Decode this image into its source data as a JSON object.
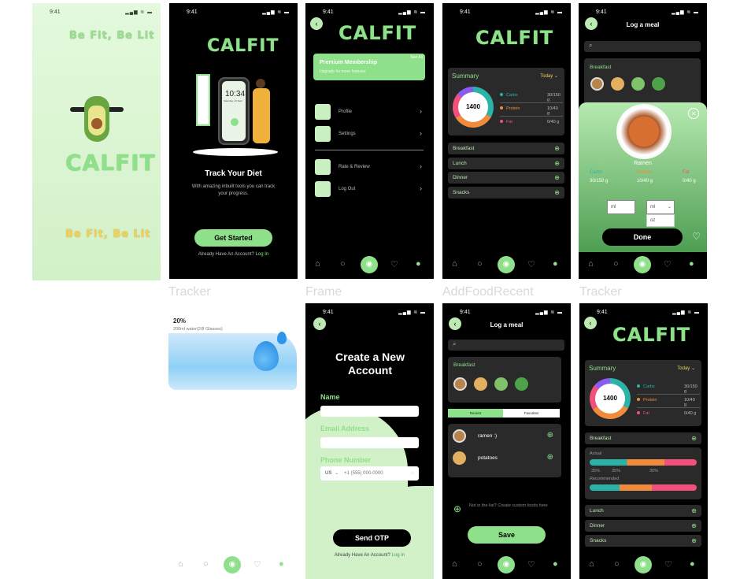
{
  "status": {
    "time": "9:41",
    "icons": "▂▄▆ ≋ ▬"
  },
  "nav_icons": [
    "home-icon",
    "search-icon",
    "camera-icon",
    "heart-icon",
    "profile-icon"
  ],
  "labels": {
    "tracker1": "Tracker",
    "frame": "Frame",
    "addfood": "AddFoodRecent",
    "tracker2": "Tracker"
  },
  "splash": {
    "tagline": "Be Fit, Be Lit",
    "brand": "CALFIT",
    "tagline_bottom": "Be Fit, Be Lit"
  },
  "onboard": {
    "brand": "CALFIT",
    "phone_time": "10:34",
    "phone_date": "Saturday, 24 Sept",
    "title": "Track Your Diet",
    "desc": "With amazing inbuilt tools you can track your progress.",
    "cta": "Get Started",
    "footer_q": "Already Have An Account?",
    "footer_link": "Log In"
  },
  "menu": {
    "brand": "CALFIT",
    "premium_title": "Premium Membership",
    "premium_badge": "See All",
    "premium_sub": "Upgrade for more features",
    "items": [
      "Profile",
      "Settings",
      "Rate & Review",
      "Log Out"
    ]
  },
  "summary": {
    "brand": "CALFIT",
    "title": "Summary",
    "period": "Today",
    "kcal": "1400",
    "macros": [
      {
        "name": "Carbs",
        "value": "30/150 g",
        "color": "#2ab3a6"
      },
      {
        "name": "Protein",
        "value": "10/40 g",
        "color": "#f08a3c"
      },
      {
        "name": "Fat",
        "value": "0/40 g",
        "color": "#f0507a"
      }
    ],
    "meals": [
      "Breakfast",
      "Lunch",
      "Dinner",
      "Snacks"
    ]
  },
  "logmeal": {
    "title": "Log a meal",
    "section": "Breakfast",
    "food_name": "Ramen",
    "macros": [
      {
        "name": "Carbs",
        "value": "30/150 g"
      },
      {
        "name": "Protein",
        "value": "10/40 g"
      },
      {
        "name": "Fat",
        "value": "0/40 g"
      }
    ],
    "unit_input": "ml",
    "unit_select": "ml",
    "unit_option": "oz",
    "done": "Done"
  },
  "water": {
    "percent": "20%",
    "desc": "200ml water(2/8 Glasses)"
  },
  "signup": {
    "title": "Create a New Account",
    "name_label": "Name",
    "email_label": "Email Address",
    "phone_label": "Phone Number",
    "country": "US",
    "phone_placeholder": "+1 (555) 000-0000",
    "cta": "Send OTP",
    "footer_q": "Already Have An Account?",
    "footer_link": "Log In"
  },
  "addfood": {
    "title": "Log a meal",
    "section": "Breakfast",
    "tab_recent": "Recent",
    "tab_favs": "Favorites",
    "items": [
      "ramen :)",
      "potatoes"
    ],
    "custom": "Not in the list? Create custom foods here",
    "save": "Save"
  },
  "tracker2": {
    "brand": "CALFIT",
    "title": "Summary",
    "period": "Today",
    "kcal": "1400",
    "macros": [
      {
        "name": "Carbs",
        "value": "30/150 g"
      },
      {
        "name": "Protein",
        "value": "10/40 g"
      },
      {
        "name": "Fat",
        "value": "0/40 g"
      }
    ],
    "breakfast": "Breakfast",
    "actual": "Actual",
    "pcts": [
      "35%",
      "35%",
      "30%"
    ],
    "recommended": "Recommended",
    "meals": [
      "Lunch",
      "Dinner",
      "Snacks"
    ]
  }
}
